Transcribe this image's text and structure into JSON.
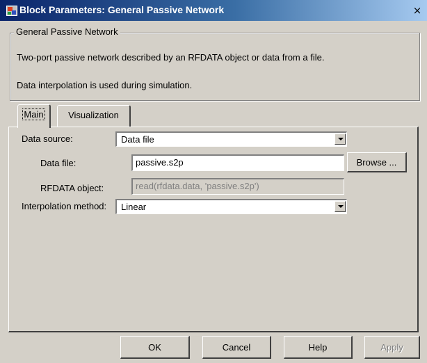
{
  "window": {
    "title": "Block Parameters: General Passive Network",
    "close_glyph": "×",
    "app_icon": "simulink-block-icon"
  },
  "group": {
    "legend": "General Passive Network",
    "description_1": "Two-port passive network described by an RFDATA object or data from a file.",
    "description_2": "Data interpolation is used during simulation."
  },
  "tabs": [
    {
      "label": "Main",
      "active": true
    },
    {
      "label": "Visualization",
      "active": false
    }
  ],
  "main": {
    "data_source": {
      "label": "Data source:",
      "value": "Data file"
    },
    "data_file": {
      "label": "Data file:",
      "value": "passive.s2p",
      "browse_label": "Browse ..."
    },
    "rfdata_object": {
      "label": "RFDATA object:",
      "value": "read(rfdata.data, 'passive.s2p')"
    },
    "interpolation": {
      "label": "Interpolation method:",
      "value": "Linear"
    }
  },
  "buttons": {
    "ok": "OK",
    "cancel": "Cancel",
    "help": "Help",
    "apply": "Apply"
  }
}
